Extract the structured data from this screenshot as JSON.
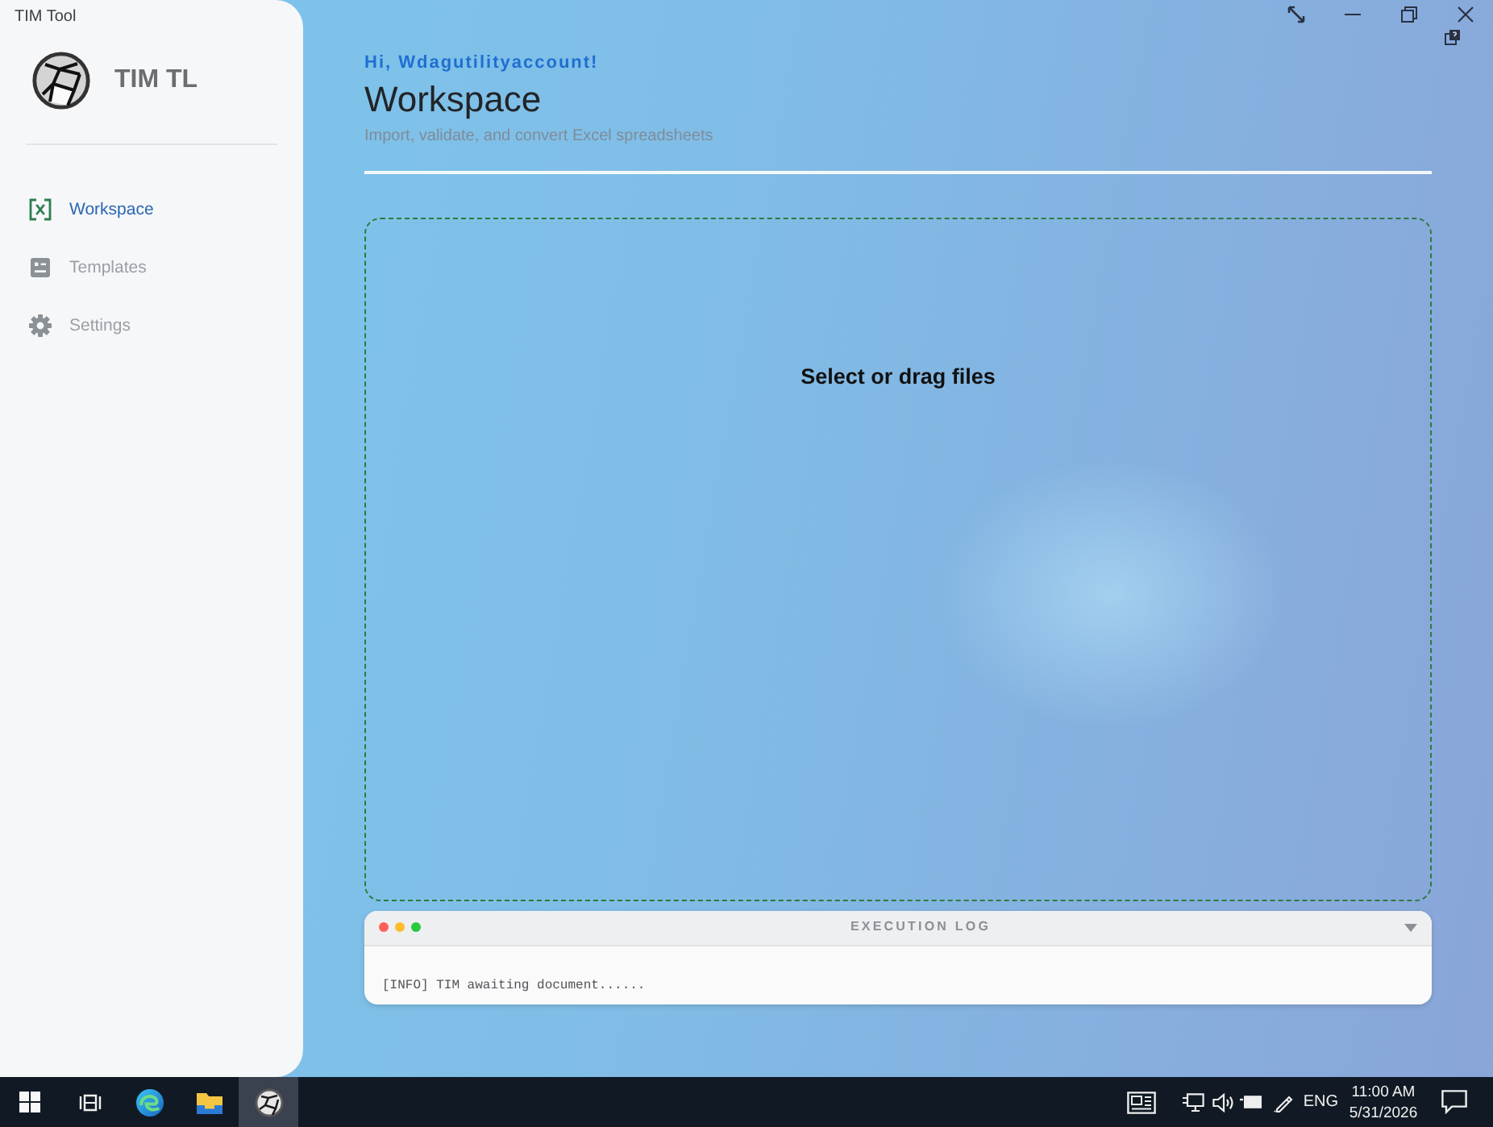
{
  "window": {
    "title": "TIM Tool"
  },
  "sidebar": {
    "app_name": "TIM TL",
    "items": [
      {
        "label": "Workspace",
        "selected": true
      },
      {
        "label": "Templates",
        "selected": false
      },
      {
        "label": "Settings",
        "selected": false
      }
    ]
  },
  "header": {
    "greeting": "Hi, Wdagutilityaccount!",
    "title": "Workspace",
    "subtitle": "Import, validate, and convert Excel spreadsheets"
  },
  "drop_zone": {
    "label": "Select or drag files"
  },
  "execution_log": {
    "title": "EXECUTION LOG",
    "lines": [
      "[INFO] TIM awaiting document......"
    ]
  },
  "taskbar": {
    "apps": [
      {
        "selected": false
      },
      {
        "selected": false
      },
      {
        "selected": false
      },
      {
        "selected": true
      }
    ],
    "language": "ENG",
    "time": "11:00 AM",
    "date": "5/31/2026"
  }
}
